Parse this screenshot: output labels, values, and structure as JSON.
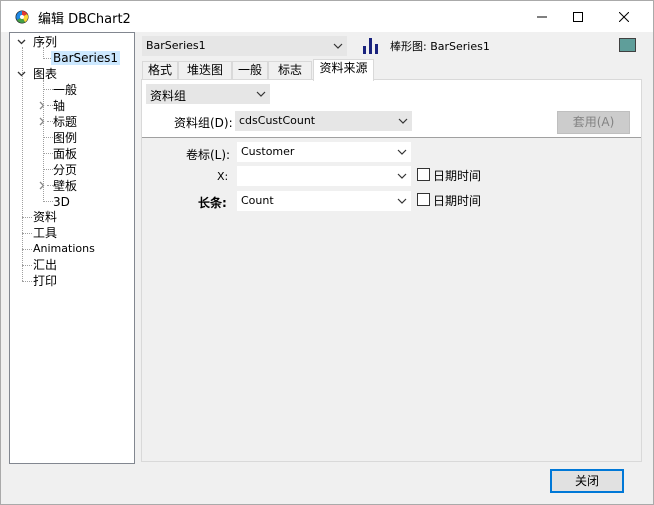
{
  "window": {
    "title": "编辑 DBChart2",
    "close_label": "关闭"
  },
  "tree": {
    "items": [
      {
        "label": "序列",
        "expanded": true
      },
      {
        "label": "BarSeries1",
        "selected": true
      },
      {
        "label": "图表",
        "expanded": true
      },
      {
        "label": "一般"
      },
      {
        "label": "轴",
        "collapsed": true
      },
      {
        "label": "标题",
        "collapsed": true
      },
      {
        "label": "图例"
      },
      {
        "label": "面板"
      },
      {
        "label": "分页"
      },
      {
        "label": "壁板",
        "collapsed": true
      },
      {
        "label": "3D"
      },
      {
        "label": "资料"
      },
      {
        "label": "工具"
      },
      {
        "label": "Animations"
      },
      {
        "label": "汇出"
      },
      {
        "label": "打印"
      }
    ]
  },
  "series_combo": {
    "value": "BarSeries1"
  },
  "series_type": {
    "label": "棒形图: BarSeries1"
  },
  "series_color": "#5f9e9a",
  "tabs": [
    {
      "label": "格式"
    },
    {
      "label": "堆迭图"
    },
    {
      "label": "一般"
    },
    {
      "label": "标志"
    },
    {
      "label": "资料来源",
      "active": true
    }
  ],
  "datasource": {
    "type_combo": "资料组",
    "dataset_label": "资料组(D):",
    "dataset_value": "cdsCustCount",
    "apply_label": "套用(A)",
    "labels_label": "卷标(L):",
    "labels_value": "Customer",
    "x_label": "X:",
    "x_value": "",
    "bar_label": "长条:",
    "bar_value": "Count",
    "datetime_label": "日期时间",
    "datetime_label_2": "日期时间"
  }
}
